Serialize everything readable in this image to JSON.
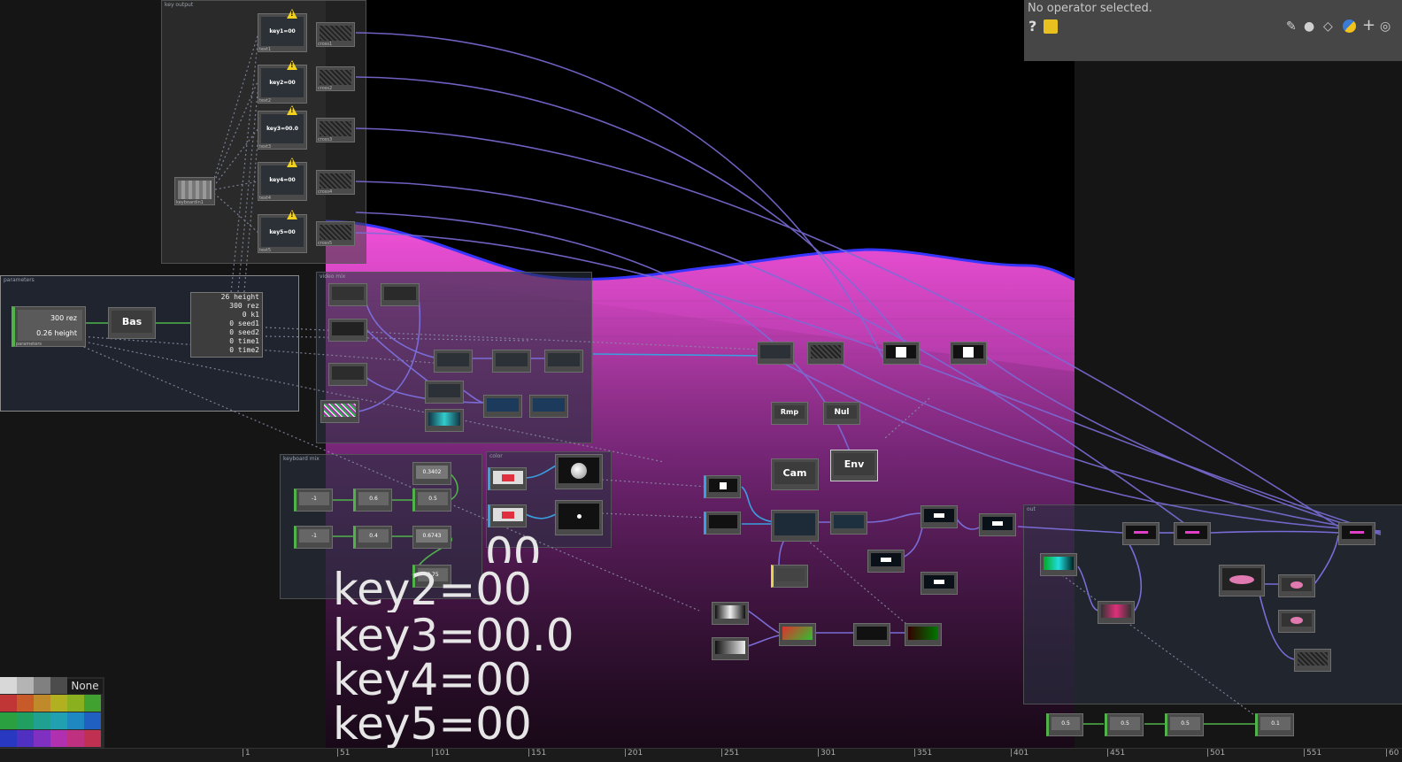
{
  "info_panel": {
    "message": "No operator selected.",
    "help_symbol": "?",
    "icons": [
      "help-icon",
      "python-help-icon",
      "edit-icon",
      "comment-icon",
      "clone-icon",
      "python-icon",
      "add-icon",
      "wireless-icon"
    ]
  },
  "networks": {
    "key_output": {
      "title": "key output"
    },
    "parameters": {
      "title": "parameters"
    },
    "video_mix": {
      "title": "video mix"
    },
    "keyboard_mix": {
      "title": "keyboard mix"
    },
    "color": {
      "title": "color"
    },
    "out": {
      "title": "out"
    }
  },
  "param_table": {
    "rows": [
      {
        "value": "26",
        "name": "height"
      },
      {
        "value": "300",
        "name": "rez"
      },
      {
        "value": "0",
        "name": "k1"
      },
      {
        "value": "0",
        "name": "seed1"
      },
      {
        "value": "0",
        "name": "seed2"
      },
      {
        "value": "0",
        "name": "time1"
      },
      {
        "value": "0",
        "name": "time2"
      }
    ],
    "label": "null1"
  },
  "param_comp": {
    "line1": "300 rez",
    "line2": "0.26 height",
    "label": "parameters"
  },
  "ops": {
    "base": "Bas",
    "cam": "Cam",
    "env": "Env",
    "ramp": "Rmp",
    "null": "Nul"
  },
  "text_ops": [
    "key1=00",
    "key2=00",
    "key3=00.0",
    "key4=00",
    "key5=00"
  ],
  "overlay_text": [
    {
      "line": "00"
    },
    {
      "line": "key2=00"
    },
    {
      "line": "key3=00.0"
    },
    {
      "line": "key4=00"
    },
    {
      "line": "key5=00"
    }
  ],
  "chop_values": [
    "-1",
    "0.6",
    "0.5",
    "-1",
    "0.4",
    "0.3402",
    "0.6743",
    "0.75",
    "0.5",
    "0.5",
    "0.5",
    "0.1"
  ],
  "palette": {
    "none_label": "None"
  },
  "colors": {
    "background": "#151515",
    "terrain_top": "#e040c8",
    "terrain_edge": "#3030ff",
    "wire": "#7a6cd6",
    "top_family": "#7b5fb8",
    "chop_family": "#4fb34a",
    "info_panel": "#464646"
  },
  "timeline": {
    "ticks": [
      "1",
      "51",
      "101",
      "151",
      "201",
      "251",
      "301",
      "351",
      "401",
      "451",
      "501",
      "551",
      "60"
    ]
  }
}
